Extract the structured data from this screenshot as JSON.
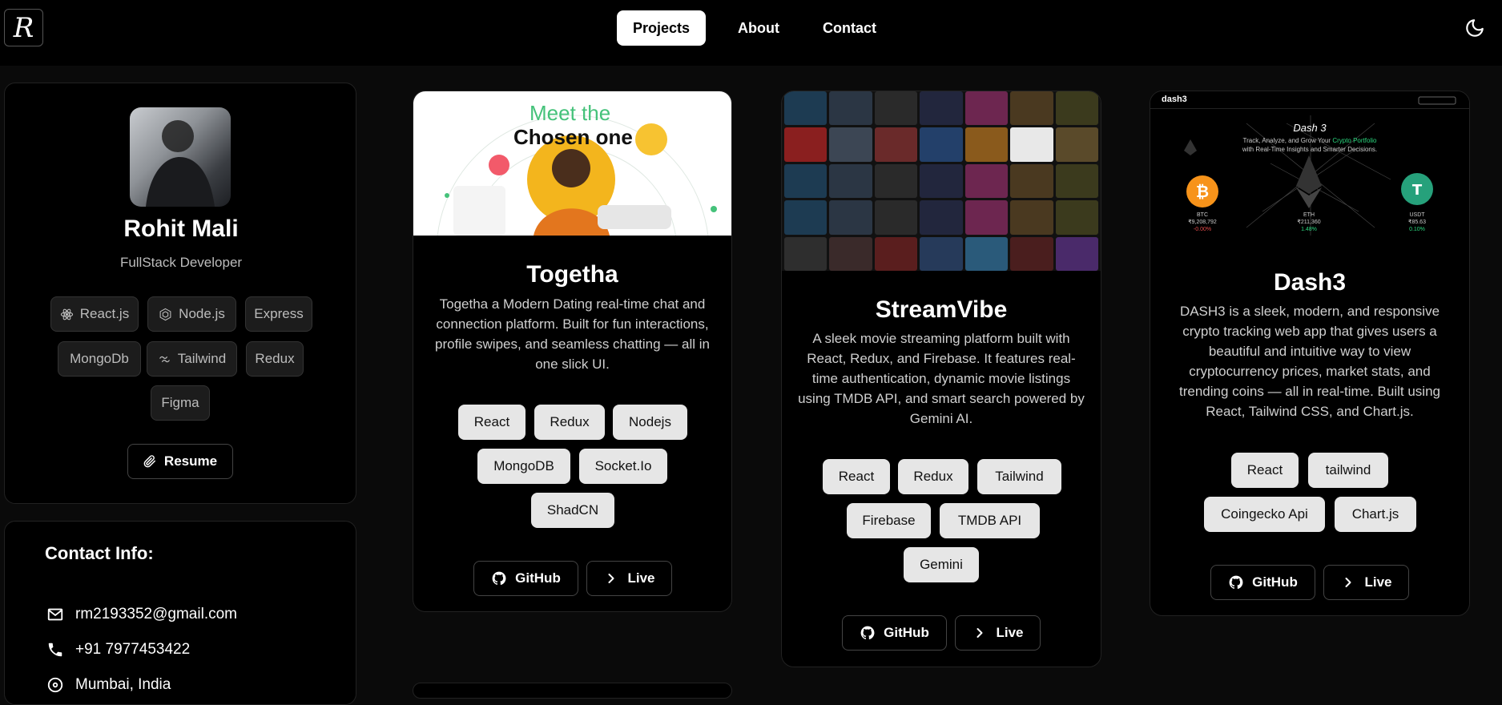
{
  "header": {
    "logo_letter": "R",
    "nav": [
      "Projects",
      "About",
      "Contact"
    ],
    "theme_icon": "moon-icon"
  },
  "profile": {
    "name": "Rohit Mali",
    "role": "FullStack Developer",
    "skills": [
      {
        "label": "React.js",
        "icon": "react-icon"
      },
      {
        "label": "Node.js",
        "icon": "nodejs-icon"
      },
      {
        "label": "Express",
        "icon": ""
      },
      {
        "label": "MongoDb",
        "icon": ""
      },
      {
        "label": "Tailwind",
        "icon": "tailwind-icon"
      },
      {
        "label": "Redux",
        "icon": ""
      },
      {
        "label": "Figma",
        "icon": ""
      }
    ],
    "resume_label": "Resume"
  },
  "contact": {
    "title": "Contact Info:",
    "email": "rm2193352@gmail.com",
    "phone": "+91 7977453422",
    "location": "Mumbai, India"
  },
  "projects": [
    {
      "title": "Togetha",
      "description": "Togetha a Modern Dating real-time chat and connection platform. Built for fun interactions, profile swipes, and seamless chatting — all in one slick UI.",
      "thumb": {
        "line1": "Meet the",
        "line2": "Chosen one"
      },
      "tags": [
        "React",
        "Redux",
        "Nodejs",
        "MongoDB",
        "Socket.Io",
        "ShadCN"
      ],
      "github_label": "GitHub",
      "live_label": "Live"
    },
    {
      "title": "StreamVibe",
      "description": "A sleek movie streaming platform built with React, Redux, and Firebase. It features real-time authentication, dynamic movie listings using TMDB API, and smart search powered by Gemini AI.",
      "tags": [
        "React",
        "Redux",
        "Tailwind",
        "Firebase",
        "TMDB API",
        "Gemini"
      ],
      "github_label": "GitHub",
      "live_label": "Live"
    },
    {
      "title": "Dash3",
      "description": "DASH3 is a sleek, modern, and responsive crypto tracking web app that gives users a beautiful and intuitive way to view cryptocurrency prices, market stats, and trending coins — all in real-time. Built using React, Tailwind CSS, and Chart.js.",
      "thumb": {
        "brand": "dash3",
        "title": "Dash 3",
        "sub_a": "Track, Analyze, and Grow Your ",
        "sub_highlight": "Crypto Portfolio",
        "sub_b": "with Real-Time Insights and Smarter Decisions.",
        "coins": [
          {
            "sym": "BTC",
            "price": "₹9,208,792",
            "chg": "-0.00%"
          },
          {
            "sym": "ETH",
            "price": "₹211,360",
            "chg": "1.48%"
          },
          {
            "sym": "USDT",
            "price": "₹85.63",
            "chg": "0.10%"
          }
        ]
      },
      "tags": [
        "React",
        "tailwind",
        "Coingecko Api",
        "Chart.js"
      ],
      "github_label": "GitHub",
      "live_label": "Live"
    }
  ],
  "colors": {
    "background": "#0a0a0a",
    "card": "#000000",
    "tag_bg": "#e6e6e6",
    "accent_green": "#45c27a"
  }
}
